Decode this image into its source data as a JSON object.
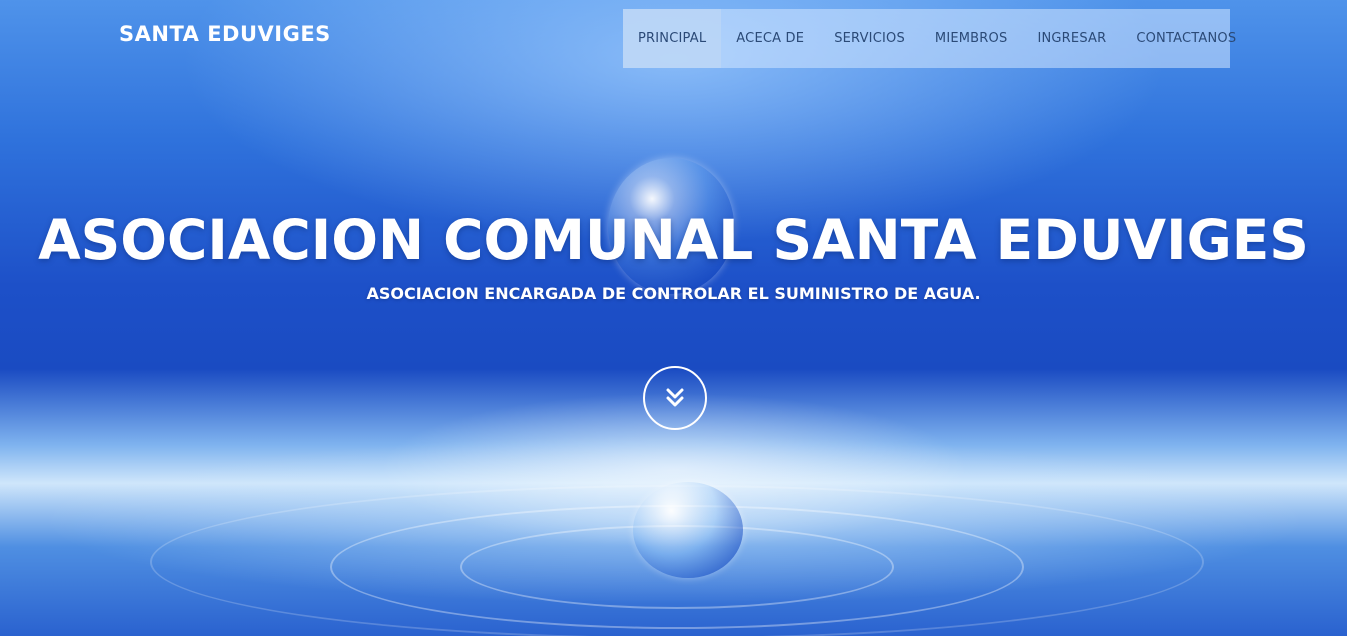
{
  "header": {
    "brand": "SANTA EDUVIGES"
  },
  "nav": {
    "items": [
      {
        "label": "PRINCIPAL",
        "active": true
      },
      {
        "label": "ACECA DE"
      },
      {
        "label": "SERVICIOS"
      },
      {
        "label": "MIEMBROS"
      },
      {
        "label": "INGRESAR"
      },
      {
        "label": "CONTACTANOS"
      }
    ]
  },
  "hero": {
    "title": "ASOCIACION COMUNAL SANTA EDUVIGES",
    "subtitle": "ASOCIACION ENCARGADA DE CONTROLAR EL SUMINISTRO DE AGUA.",
    "scroll_icon": "double-chevron-down-icon"
  },
  "colors": {
    "text": "#ffffff",
    "nav_text": "#2b4a77",
    "water_blue": "#1d50c8"
  }
}
